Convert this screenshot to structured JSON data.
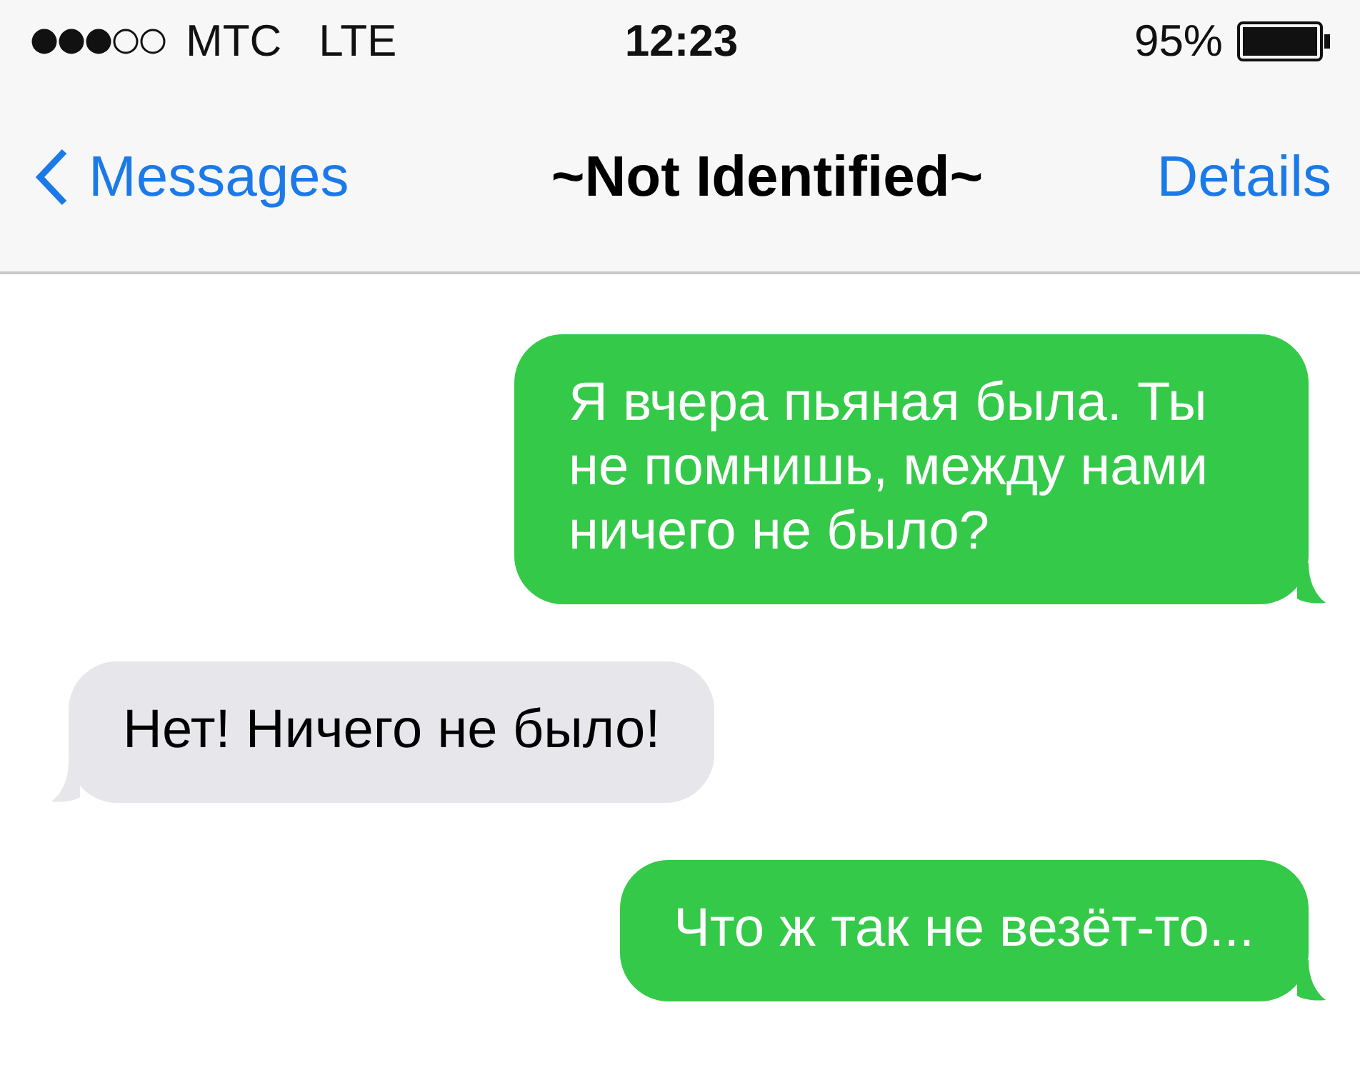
{
  "status_bar": {
    "carrier": "МТС",
    "network": "LTE",
    "time": "12:23",
    "battery": "95%"
  },
  "nav_bar": {
    "back": "Messages",
    "title": "~Not Identified~",
    "action": "Details"
  },
  "messages": [
    {
      "kind": "sent",
      "text": "Я вчера пьяная была. Ты не помнишь, между нами ничего не было?"
    },
    {
      "kind": "received",
      "text": "Нет! Ничего не было!"
    },
    {
      "kind": "sent",
      "text": "Что ж так не везёт-то..."
    }
  ]
}
